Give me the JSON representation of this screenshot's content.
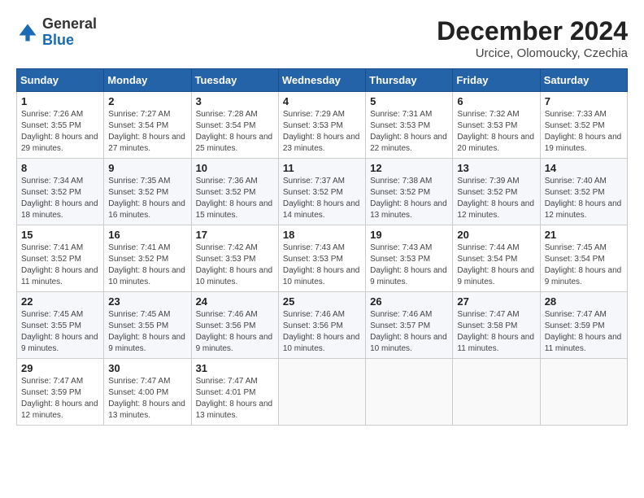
{
  "header": {
    "logo_general": "General",
    "logo_blue": "Blue",
    "month_title": "December 2024",
    "location": "Urcice, Olomoucky, Czechia"
  },
  "days_of_week": [
    "Sunday",
    "Monday",
    "Tuesday",
    "Wednesday",
    "Thursday",
    "Friday",
    "Saturday"
  ],
  "weeks": [
    [
      {
        "day": 1,
        "sunrise": "7:26 AM",
        "sunset": "3:55 PM",
        "daylight": "8 hours and 29 minutes."
      },
      {
        "day": 2,
        "sunrise": "7:27 AM",
        "sunset": "3:54 PM",
        "daylight": "8 hours and 27 minutes."
      },
      {
        "day": 3,
        "sunrise": "7:28 AM",
        "sunset": "3:54 PM",
        "daylight": "8 hours and 25 minutes."
      },
      {
        "day": 4,
        "sunrise": "7:29 AM",
        "sunset": "3:53 PM",
        "daylight": "8 hours and 23 minutes."
      },
      {
        "day": 5,
        "sunrise": "7:31 AM",
        "sunset": "3:53 PM",
        "daylight": "8 hours and 22 minutes."
      },
      {
        "day": 6,
        "sunrise": "7:32 AM",
        "sunset": "3:53 PM",
        "daylight": "8 hours and 20 minutes."
      },
      {
        "day": 7,
        "sunrise": "7:33 AM",
        "sunset": "3:52 PM",
        "daylight": "8 hours and 19 minutes."
      }
    ],
    [
      {
        "day": 8,
        "sunrise": "7:34 AM",
        "sunset": "3:52 PM",
        "daylight": "8 hours and 18 minutes."
      },
      {
        "day": 9,
        "sunrise": "7:35 AM",
        "sunset": "3:52 PM",
        "daylight": "8 hours and 16 minutes."
      },
      {
        "day": 10,
        "sunrise": "7:36 AM",
        "sunset": "3:52 PM",
        "daylight": "8 hours and 15 minutes."
      },
      {
        "day": 11,
        "sunrise": "7:37 AM",
        "sunset": "3:52 PM",
        "daylight": "8 hours and 14 minutes."
      },
      {
        "day": 12,
        "sunrise": "7:38 AM",
        "sunset": "3:52 PM",
        "daylight": "8 hours and 13 minutes."
      },
      {
        "day": 13,
        "sunrise": "7:39 AM",
        "sunset": "3:52 PM",
        "daylight": "8 hours and 12 minutes."
      },
      {
        "day": 14,
        "sunrise": "7:40 AM",
        "sunset": "3:52 PM",
        "daylight": "8 hours and 12 minutes."
      }
    ],
    [
      {
        "day": 15,
        "sunrise": "7:41 AM",
        "sunset": "3:52 PM",
        "daylight": "8 hours and 11 minutes."
      },
      {
        "day": 16,
        "sunrise": "7:41 AM",
        "sunset": "3:52 PM",
        "daylight": "8 hours and 10 minutes."
      },
      {
        "day": 17,
        "sunrise": "7:42 AM",
        "sunset": "3:53 PM",
        "daylight": "8 hours and 10 minutes."
      },
      {
        "day": 18,
        "sunrise": "7:43 AM",
        "sunset": "3:53 PM",
        "daylight": "8 hours and 10 minutes."
      },
      {
        "day": 19,
        "sunrise": "7:43 AM",
        "sunset": "3:53 PM",
        "daylight": "8 hours and 9 minutes."
      },
      {
        "day": 20,
        "sunrise": "7:44 AM",
        "sunset": "3:54 PM",
        "daylight": "8 hours and 9 minutes."
      },
      {
        "day": 21,
        "sunrise": "7:45 AM",
        "sunset": "3:54 PM",
        "daylight": "8 hours and 9 minutes."
      }
    ],
    [
      {
        "day": 22,
        "sunrise": "7:45 AM",
        "sunset": "3:55 PM",
        "daylight": "8 hours and 9 minutes."
      },
      {
        "day": 23,
        "sunrise": "7:45 AM",
        "sunset": "3:55 PM",
        "daylight": "8 hours and 9 minutes."
      },
      {
        "day": 24,
        "sunrise": "7:46 AM",
        "sunset": "3:56 PM",
        "daylight": "8 hours and 9 minutes."
      },
      {
        "day": 25,
        "sunrise": "7:46 AM",
        "sunset": "3:56 PM",
        "daylight": "8 hours and 10 minutes."
      },
      {
        "day": 26,
        "sunrise": "7:46 AM",
        "sunset": "3:57 PM",
        "daylight": "8 hours and 10 minutes."
      },
      {
        "day": 27,
        "sunrise": "7:47 AM",
        "sunset": "3:58 PM",
        "daylight": "8 hours and 11 minutes."
      },
      {
        "day": 28,
        "sunrise": "7:47 AM",
        "sunset": "3:59 PM",
        "daylight": "8 hours and 11 minutes."
      }
    ],
    [
      {
        "day": 29,
        "sunrise": "7:47 AM",
        "sunset": "3:59 PM",
        "daylight": "8 hours and 12 minutes."
      },
      {
        "day": 30,
        "sunrise": "7:47 AM",
        "sunset": "4:00 PM",
        "daylight": "8 hours and 13 minutes."
      },
      {
        "day": 31,
        "sunrise": "7:47 AM",
        "sunset": "4:01 PM",
        "daylight": "8 hours and 13 minutes."
      },
      null,
      null,
      null,
      null
    ]
  ]
}
